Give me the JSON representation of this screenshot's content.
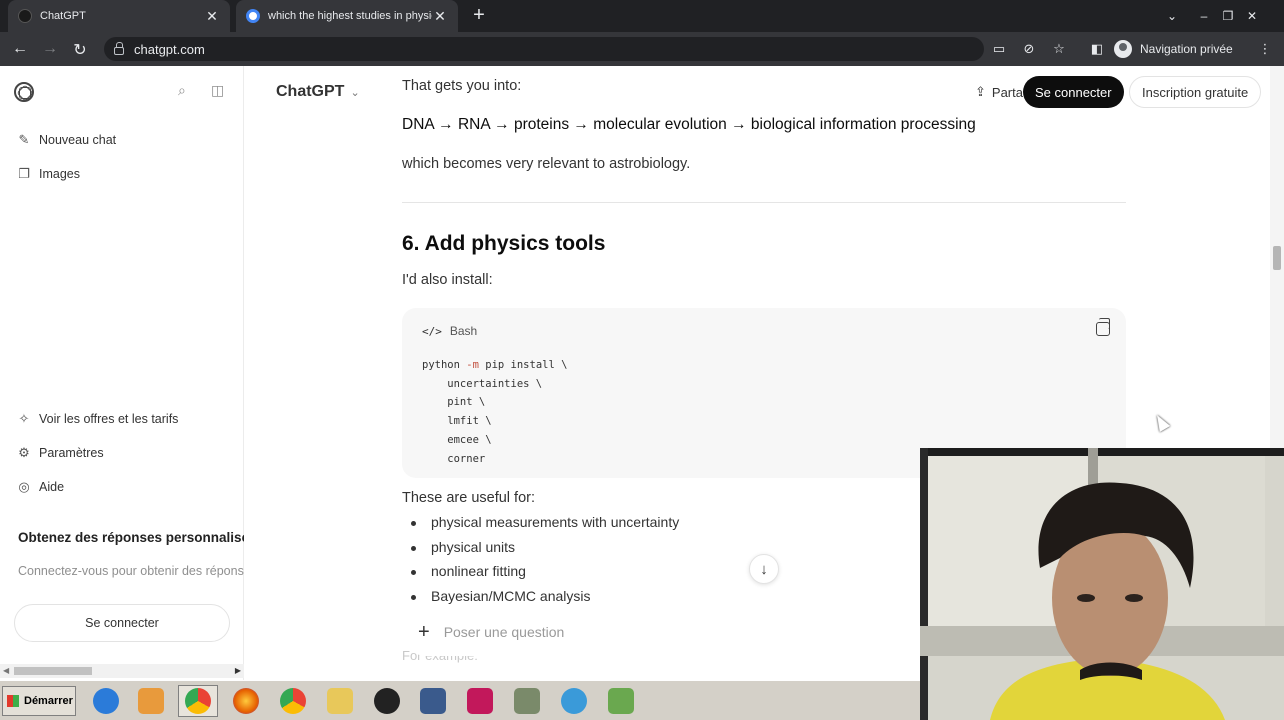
{
  "browser": {
    "tabs": [
      {
        "title": "ChatGPT",
        "close": "✕"
      },
      {
        "title": "which the highest studies in physics",
        "close": "✕"
      }
    ],
    "new_tab": "+",
    "window_controls": [
      "⌄",
      "–",
      "❐",
      "✕"
    ],
    "url": "chatgpt.com",
    "profile_label": "Navigation privée",
    "nav": {
      "back": "←",
      "forward": "→",
      "reload": "↻"
    },
    "toolbar_icons": [
      "clipboard-icon",
      "eye-off-icon",
      "star-icon",
      "sidepanel-icon",
      "menu-icon"
    ]
  },
  "sidebar": {
    "items": [
      {
        "label": "Nouveau chat",
        "icon": "edit-icon",
        "glyph": "✎"
      },
      {
        "label": "Images",
        "icon": "images-icon",
        "glyph": "❐"
      }
    ],
    "bottom_items": [
      {
        "label": "Voir les offres et les tarifs",
        "icon": "sparkle-icon",
        "glyph": "✧"
      },
      {
        "label": "Paramètres",
        "icon": "gear-icon",
        "glyph": "⚙"
      },
      {
        "label": "Aide",
        "icon": "help-icon",
        "glyph": "◎"
      }
    ],
    "promo_title": "Obtenez des réponses personnalisées",
    "promo_text": "Connectez-vous pour obtenir des réponses",
    "login_button": "Se connecter"
  },
  "header": {
    "model": "ChatGPT",
    "model_chevron": "⌄",
    "share": "Partager",
    "login": "Se connecter",
    "signup": "Inscription gratuite"
  },
  "content": {
    "line1": "That gets you into:",
    "chain": "DNA → RNA → proteins → molecular evolution → biological information processing",
    "line3": "which becomes very relevant to astrobiology.",
    "heading": "6. Add physics tools",
    "intro": "I'd also install:",
    "code_lang": "Bash",
    "code_lines": [
      {
        "pre": "python ",
        "kw": "-m",
        "post": " pip install \\"
      },
      {
        "pre": "    uncertainties \\",
        "kw": "",
        "post": ""
      },
      {
        "pre": "    pint \\",
        "kw": "",
        "post": ""
      },
      {
        "pre": "    lmfit \\",
        "kw": "",
        "post": ""
      },
      {
        "pre": "    emcee \\",
        "kw": "",
        "post": ""
      },
      {
        "pre": "    corner",
        "kw": "",
        "post": ""
      }
    ],
    "useful_for": "These are useful for:",
    "bullets": [
      "physical measurements with uncertainty",
      "physical units",
      "nonlinear fitting",
      "Bayesian/MCMC analysis"
    ],
    "faded_next": "For example:"
  },
  "composer": {
    "placeholder": "Poser une question",
    "plus": "+"
  },
  "scroll_down": "↓",
  "taskbar": {
    "start_label": "Démarrer",
    "apps": [
      {
        "icon": "internet-explorer-icon",
        "color": "#2b7bd9"
      },
      {
        "icon": "media-player-icon",
        "color": "#e89a3c"
      },
      {
        "icon": "chrome-icon",
        "color": "#34a853"
      },
      {
        "icon": "firefox-icon",
        "color": "#e66000"
      },
      {
        "icon": "chrome-icon",
        "color": "#ea4335"
      },
      {
        "icon": "folder-icon",
        "color": "#e8c85a"
      },
      {
        "icon": "obs-icon",
        "color": "#222222"
      },
      {
        "icon": "cube-app-icon",
        "color": "#3a5a8c"
      },
      {
        "icon": "recorder-icon",
        "color": "#c2185b"
      },
      {
        "icon": "image-app-icon",
        "color": "#7a8a6a"
      },
      {
        "icon": "cloud-app-icon",
        "color": "#3a9ad9"
      },
      {
        "icon": "chart-app-icon",
        "color": "#6aa84f"
      }
    ]
  }
}
